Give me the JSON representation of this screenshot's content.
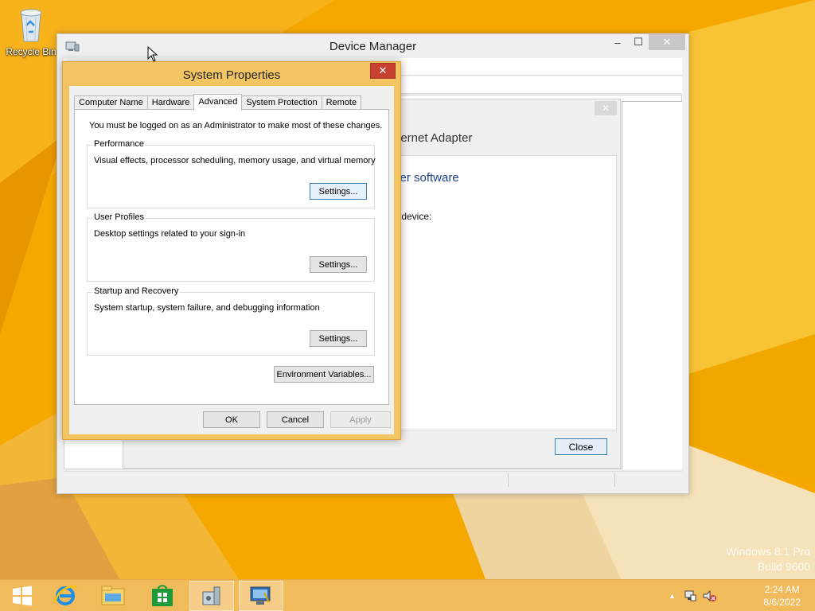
{
  "colors": {
    "wallpaper_base": "#f5a800",
    "wallpaper_light": "#fbbb22",
    "wallpaper_dark": "#e08c00",
    "dialog_frame": "#f3c462",
    "close_red": "#c84031",
    "taskbar": "#f0ba60",
    "link_blue": "#1e3f8c"
  },
  "desktop": {
    "recycle_bin_label": "Recycle Bin",
    "recycle_bin_icon": "recycle-bin-icon"
  },
  "device_manager": {
    "title": "Device Manager",
    "icon": "device-manager-icon",
    "minimize": "–",
    "maximize": "☐",
    "close": "✕"
  },
  "adapter_dialog": {
    "close": "✕",
    "heading_fragment": "hernet Adapter",
    "driver_fragment": "ver software",
    "device_fragment": "s device:",
    "close_button": "Close"
  },
  "system_properties": {
    "title": "System Properties",
    "close": "✕",
    "tabs": [
      {
        "label": "Computer Name",
        "active": false
      },
      {
        "label": "Hardware",
        "active": false
      },
      {
        "label": "Advanced",
        "active": true
      },
      {
        "label": "System Protection",
        "active": false
      },
      {
        "label": "Remote",
        "active": false
      }
    ],
    "admin_note": "You must be logged on as an Administrator to make most of these changes.",
    "groups": {
      "performance": {
        "legend": "Performance",
        "desc": "Visual effects, processor scheduling, memory usage, and virtual memory",
        "button": "Settings..."
      },
      "user_profiles": {
        "legend": "User Profiles",
        "desc": "Desktop settings related to your sign-in",
        "button": "Settings..."
      },
      "startup_recovery": {
        "legend": "Startup and Recovery",
        "desc": "System startup, system failure, and debugging information",
        "button": "Settings..."
      }
    },
    "env_button": "Environment Variables...",
    "ok": "OK",
    "cancel": "Cancel",
    "apply": "Apply"
  },
  "taskbar": {
    "start_icon": "windows-start-icon",
    "ie_icon": "internet-explorer-icon",
    "explorer_icon": "file-explorer-icon",
    "store_icon": "windows-store-icon",
    "system_icon": "system-properties-icon",
    "devmgr_icon": "device-manager-icon",
    "tray": {
      "up_arrow": "▲",
      "network_icon": "network-icon",
      "volume_icon": "volume-muted-icon"
    },
    "time": "2:24 AM",
    "date": "8/6/2022"
  },
  "watermark": {
    "line1": "Windows 8.1 Pro",
    "line2": "Build 9600"
  }
}
